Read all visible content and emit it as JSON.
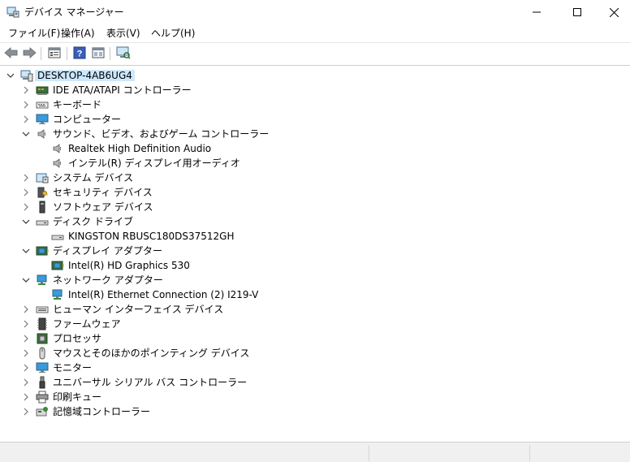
{
  "window": {
    "title": "デバイス マネージャー",
    "icon": "device-manager-icon"
  },
  "window_controls": {
    "minimize": "minimize-icon",
    "maximize": "maximize-icon",
    "close": "close-icon"
  },
  "menu": [
    {
      "label": "ファイル(F)"
    },
    {
      "label": "操作(A)"
    },
    {
      "label": "表示(V)"
    },
    {
      "label": "ヘルプ(H)"
    }
  ],
  "toolbar": [
    {
      "icon": "back-arrow-icon"
    },
    {
      "icon": "forward-arrow-icon"
    },
    {
      "icon": "properties-icon"
    },
    {
      "icon": "help-icon"
    },
    {
      "icon": "view-icon"
    },
    {
      "icon": "scan-hardware-icon"
    }
  ],
  "tree": {
    "root": {
      "label": "DESKTOP-4AB6UG4",
      "icon": "computer-icon",
      "expanded": true
    },
    "items": [
      {
        "label": "IDE ATA/ATAPI コントローラー",
        "icon": "ide-controller-icon",
        "depth": 1,
        "expander": "collapsed"
      },
      {
        "label": "キーボード",
        "icon": "keyboard-icon",
        "depth": 1,
        "expander": "collapsed"
      },
      {
        "label": "コンピューター",
        "icon": "monitor-icon",
        "depth": 1,
        "expander": "collapsed"
      },
      {
        "label": "サウンド、ビデオ、およびゲーム コントローラー",
        "icon": "speaker-icon",
        "depth": 1,
        "expander": "expanded"
      },
      {
        "label": "Realtek High Definition Audio",
        "icon": "speaker-icon",
        "depth": 2,
        "expander": "none"
      },
      {
        "label": "インテル(R) ディスプレイ用オーディオ",
        "icon": "speaker-icon",
        "depth": 2,
        "expander": "none"
      },
      {
        "label": "システム デバイス",
        "icon": "system-device-icon",
        "depth": 1,
        "expander": "collapsed"
      },
      {
        "label": "セキュリティ デバイス",
        "icon": "security-key-icon",
        "depth": 1,
        "expander": "collapsed"
      },
      {
        "label": "ソフトウェア デバイス",
        "icon": "software-device-icon",
        "depth": 1,
        "expander": "collapsed"
      },
      {
        "label": "ディスク ドライブ",
        "icon": "disk-drive-icon",
        "depth": 1,
        "expander": "expanded"
      },
      {
        "label": "KINGSTON RBUSC180DS37512GH",
        "icon": "disk-drive-icon",
        "depth": 2,
        "expander": "none"
      },
      {
        "label": "ディスプレイ アダプター",
        "icon": "display-adapter-icon",
        "depth": 1,
        "expander": "expanded"
      },
      {
        "label": "Intel(R) HD Graphics 530",
        "icon": "display-adapter-icon",
        "depth": 2,
        "expander": "none"
      },
      {
        "label": "ネットワーク アダプター",
        "icon": "network-adapter-icon",
        "depth": 1,
        "expander": "expanded"
      },
      {
        "label": "Intel(R) Ethernet Connection (2) I219-V",
        "icon": "network-adapter-icon",
        "depth": 2,
        "expander": "none"
      },
      {
        "label": "ヒューマン インターフェイス デバイス",
        "icon": "hid-icon",
        "depth": 1,
        "expander": "collapsed"
      },
      {
        "label": "ファームウェア",
        "icon": "firmware-icon",
        "depth": 1,
        "expander": "collapsed"
      },
      {
        "label": "プロセッサ",
        "icon": "processor-icon",
        "depth": 1,
        "expander": "collapsed"
      },
      {
        "label": "マウスとそのほかのポインティング デバイス",
        "icon": "mouse-icon",
        "depth": 1,
        "expander": "collapsed"
      },
      {
        "label": "モニター",
        "icon": "monitor-icon",
        "depth": 1,
        "expander": "collapsed"
      },
      {
        "label": "ユニバーサル シリアル バス コントローラー",
        "icon": "usb-icon",
        "depth": 1,
        "expander": "collapsed"
      },
      {
        "label": "印刷キュー",
        "icon": "printer-icon",
        "depth": 1,
        "expander": "collapsed"
      },
      {
        "label": "記憶域コントローラー",
        "icon": "storage-controller-icon",
        "depth": 1,
        "expander": "collapsed"
      }
    ]
  },
  "status_bar": {
    "sections": [
      "",
      "",
      ""
    ]
  }
}
